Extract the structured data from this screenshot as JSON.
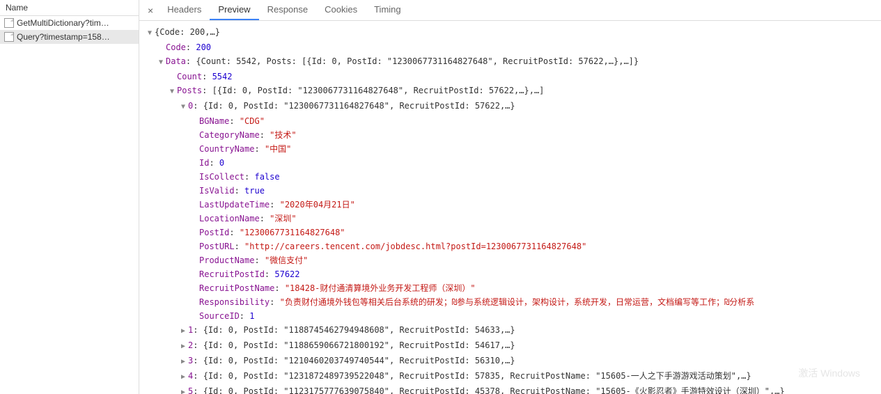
{
  "leftPanel": {
    "header": "Name",
    "items": [
      {
        "name": "GetMultiDictionary?tim…",
        "selected": false
      },
      {
        "name": "Query?timestamp=158…",
        "selected": true
      }
    ]
  },
  "tabs": {
    "close": "×",
    "items": [
      "Headers",
      "Preview",
      "Response",
      "Cookies",
      "Timing"
    ],
    "active": "Preview"
  },
  "tree": {
    "root_summary": "{Code: 200,…}",
    "code_key": "Code",
    "code_val": "200",
    "data_key": "Data",
    "data_summary": "{Count: 5542, Posts: [{Id: 0, PostId: \"1230067731164827648\", RecruitPostId: 57622,…},…]}",
    "count_key": "Count",
    "count_val": "5542",
    "posts_key": "Posts",
    "posts_summary": "[{Id: 0, PostId: \"1230067731164827648\", RecruitPostId: 57622,…},…]",
    "p0_key": "0",
    "p0_summary": "{Id: 0, PostId: \"1230067731164827648\", RecruitPostId: 57622,…}",
    "fields": {
      "BGName": {
        "k": "BGName",
        "v": "\"CDG\"",
        "t": "string"
      },
      "CategoryName": {
        "k": "CategoryName",
        "v": "\"技术\"",
        "t": "string"
      },
      "CountryName": {
        "k": "CountryName",
        "v": "\"中国\"",
        "t": "string"
      },
      "Id": {
        "k": "Id",
        "v": "0",
        "t": "number"
      },
      "IsCollect": {
        "k": "IsCollect",
        "v": "false",
        "t": "boolean"
      },
      "IsValid": {
        "k": "IsValid",
        "v": "true",
        "t": "boolean"
      },
      "LastUpdateTime": {
        "k": "LastUpdateTime",
        "v": "\"2020年04月21日\"",
        "t": "string"
      },
      "LocationName": {
        "k": "LocationName",
        "v": "\"深圳\"",
        "t": "string"
      },
      "PostId": {
        "k": "PostId",
        "v": "\"1230067731164827648\"",
        "t": "string"
      },
      "PostURL": {
        "k": "PostURL",
        "v": "\"http://careers.tencent.com/jobdesc.html?postId=1230067731164827648\"",
        "t": "string"
      },
      "ProductName": {
        "k": "ProductName",
        "v": "\"微信支付\"",
        "t": "string"
      },
      "RecruitPostId": {
        "k": "RecruitPostId",
        "v": "57622",
        "t": "number"
      },
      "RecruitPostName": {
        "k": "RecruitPostName",
        "v": "\"18428-财付通清算境外业务开发工程师（深圳）\"",
        "t": "string"
      },
      "Responsibility": {
        "k": "Responsibility",
        "v": "\"负责财付通境外钱包等相关后台系统的研发；₪参与系统逻辑设计，架构设计，系统开发，日常运营，文档编写等工作；₪分析系",
        "t": "string"
      },
      "SourceID": {
        "k": "SourceID",
        "v": "1",
        "t": "number"
      }
    },
    "collapsed": [
      {
        "k": "1",
        "s": "{Id: 0, PostId: \"1188745462794948608\", RecruitPostId: 54633,…}"
      },
      {
        "k": "2",
        "s": "{Id: 0, PostId: \"1188659066721800192\", RecruitPostId: 54617,…}"
      },
      {
        "k": "3",
        "s": "{Id: 0, PostId: \"1210460203749740544\", RecruitPostId: 56310,…}"
      },
      {
        "k": "4",
        "s": "{Id: 0, PostId: \"1231872489739522048\", RecruitPostId: 57835, RecruitPostName: \"15605-一人之下手游游戏活动策划\",…}"
      },
      {
        "k": "5",
        "s": "{Id: 0, PostId: \"1123175777639075840\", RecruitPostId: 45378, RecruitPostName: \"15605-《火影忍者》手游特效设计（深圳）\",…}"
      }
    ]
  },
  "watermark": "激活 Windows"
}
